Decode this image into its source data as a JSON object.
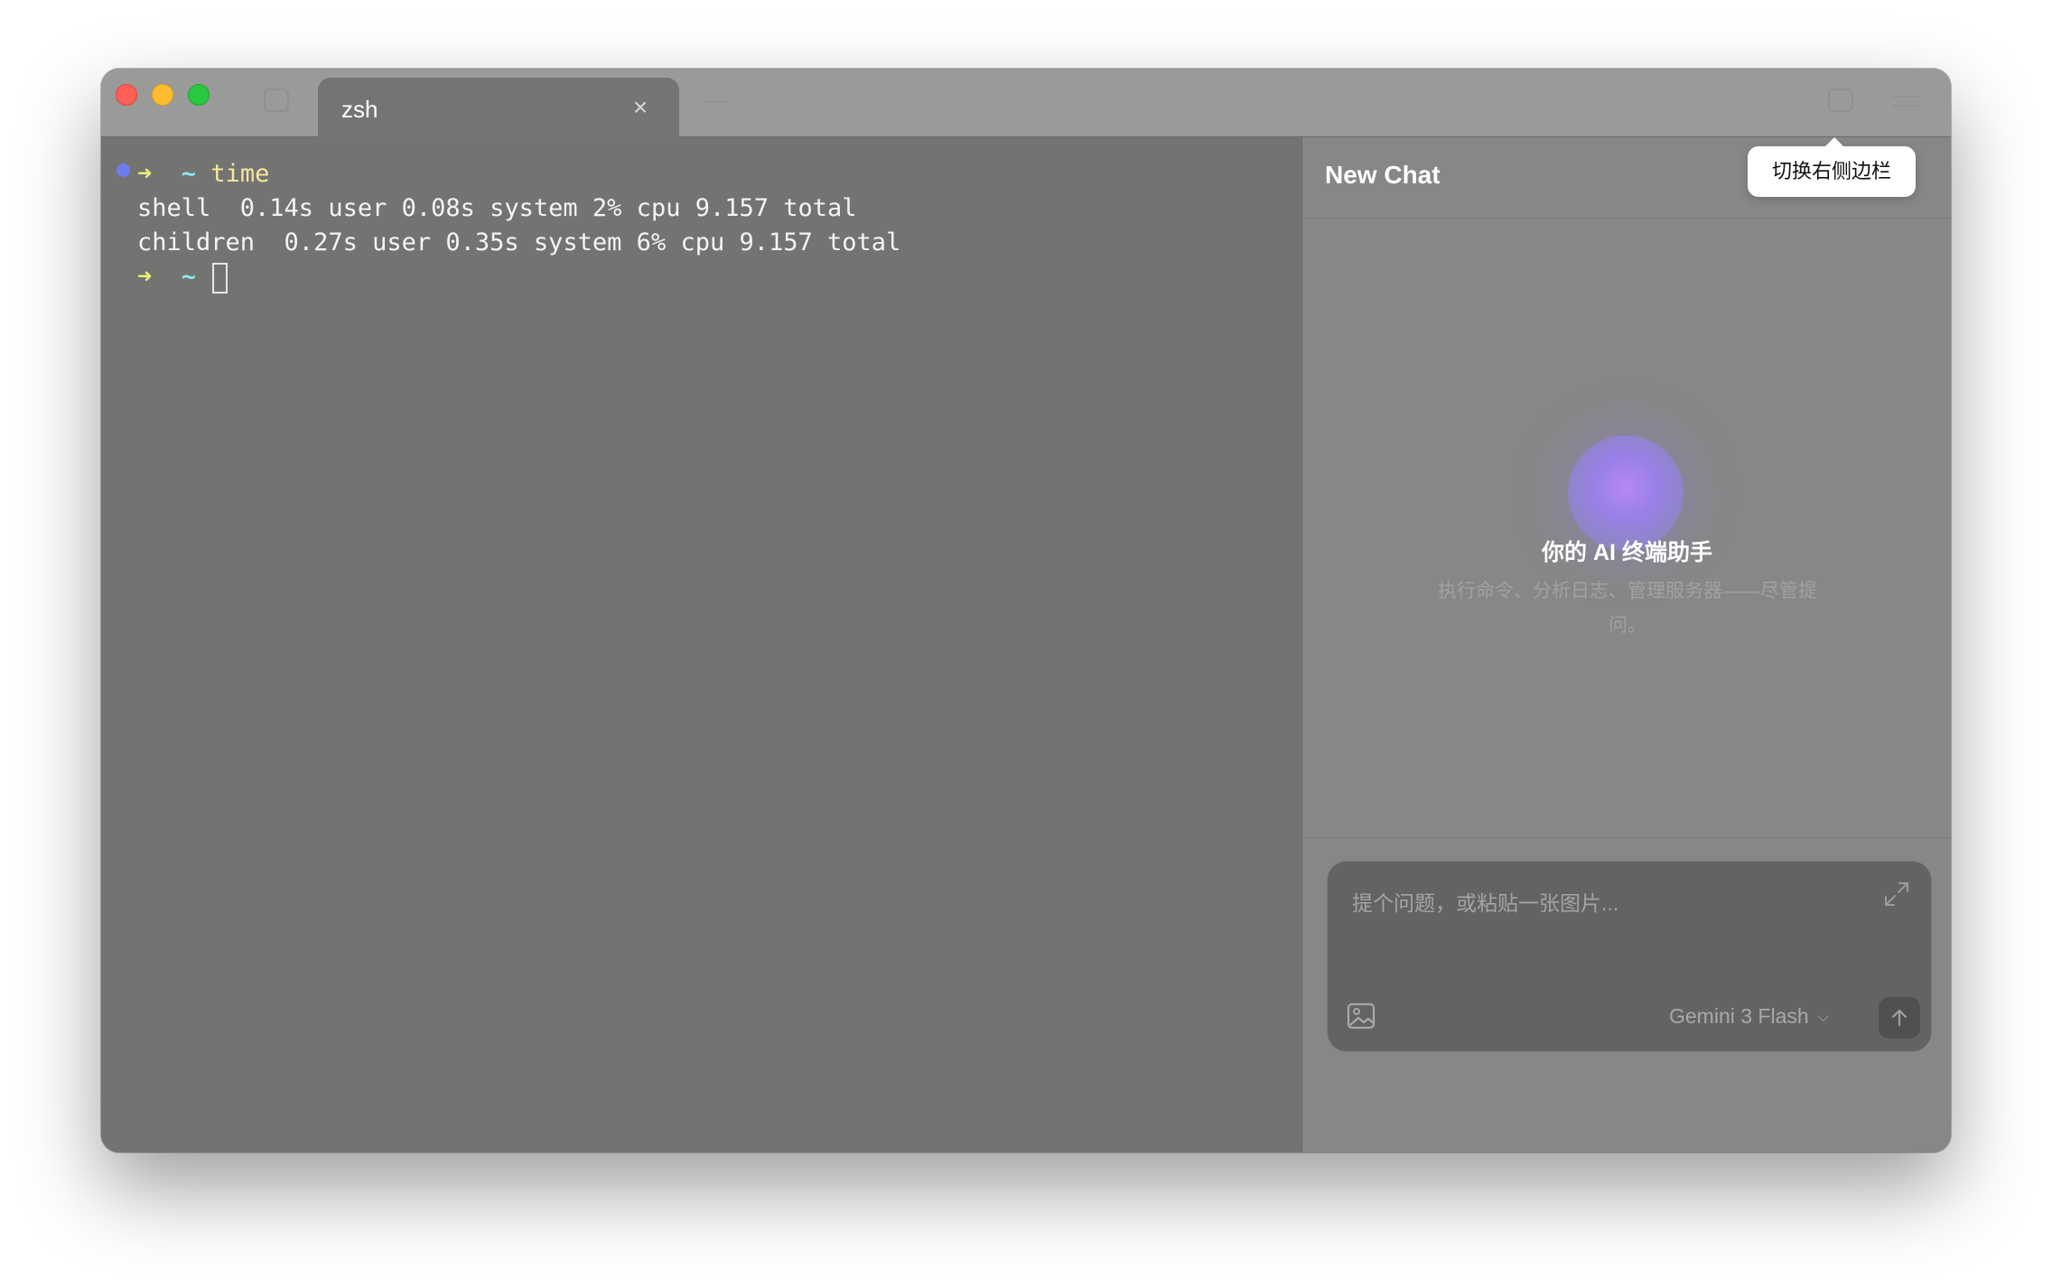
{
  "window": {
    "tab": {
      "label": "zsh"
    }
  },
  "terminal": {
    "lines": [
      {
        "prompt": "➜",
        "dir": "~",
        "command": "time"
      },
      {
        "text": "shell  0.14s user 0.08s system 2% cpu 9.157 total"
      },
      {
        "text": "children  0.27s user 0.35s system 6% cpu 9.157 total"
      },
      {
        "prompt": "➜",
        "dir": "~",
        "command": ""
      }
    ]
  },
  "sidebar": {
    "title": "New Chat",
    "tooltip": "切换右侧边栏",
    "welcome": {
      "title": "你的 AI 终端助手",
      "subtitle": "执行命令、分析日志、管理服务器——尽管提问。"
    },
    "composer": {
      "placeholder": "提个问题，或粘贴一张图片...",
      "model": "Gemini 3 Flash"
    }
  },
  "colors": {
    "terminal_bg": "#737472",
    "sidebar_bg": "#878886",
    "prompt_arrow": "#e8f07a",
    "prompt_dir": "#8fe6f0",
    "command": "#f6e79a",
    "status_dot": "#6c7cf0",
    "orb": "#9a80e8"
  },
  "icons": {
    "tab_close": "close-icon",
    "expand": "expand-icon",
    "attach_image": "image-icon",
    "model_dropdown": "chevron-down-icon",
    "send": "arrow-up-icon"
  }
}
